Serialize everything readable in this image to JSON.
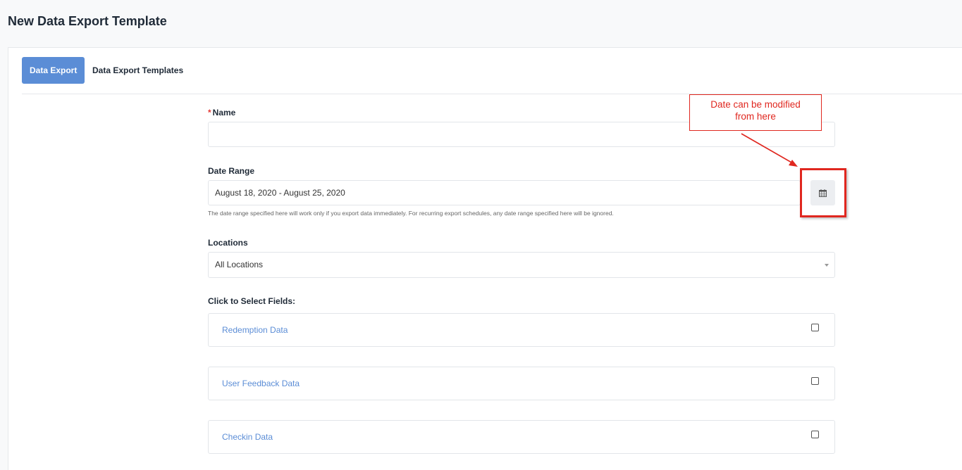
{
  "page": {
    "title": "New Data Export Template"
  },
  "tabs": [
    {
      "label": "Data Export",
      "active": true
    },
    {
      "label": "Data Export Templates",
      "active": false
    }
  ],
  "form": {
    "name": {
      "required_mark": "*",
      "label": "Name",
      "value": ""
    },
    "date_range": {
      "label": "Date Range",
      "value": "August 18, 2020 - August 25, 2020",
      "help": "The date range specified here will work only if you export data immediately. For recurring export schedules, any date range specified here will be ignored.",
      "button_icon": "calendar-icon"
    },
    "locations": {
      "label": "Locations",
      "selected": "All Locations"
    },
    "fields_section": {
      "label": "Click to Select Fields:",
      "items": [
        {
          "label": "Redemption Data",
          "checked": false
        },
        {
          "label": "User Feedback Data",
          "checked": false
        },
        {
          "label": "Checkin Data",
          "checked": false
        }
      ]
    }
  },
  "annotation": {
    "line1": "Date can be modified",
    "line2": "from here",
    "color": "#e0271f"
  },
  "colors": {
    "accent": "#5b8dd6",
    "annotation": "#e0271f"
  }
}
